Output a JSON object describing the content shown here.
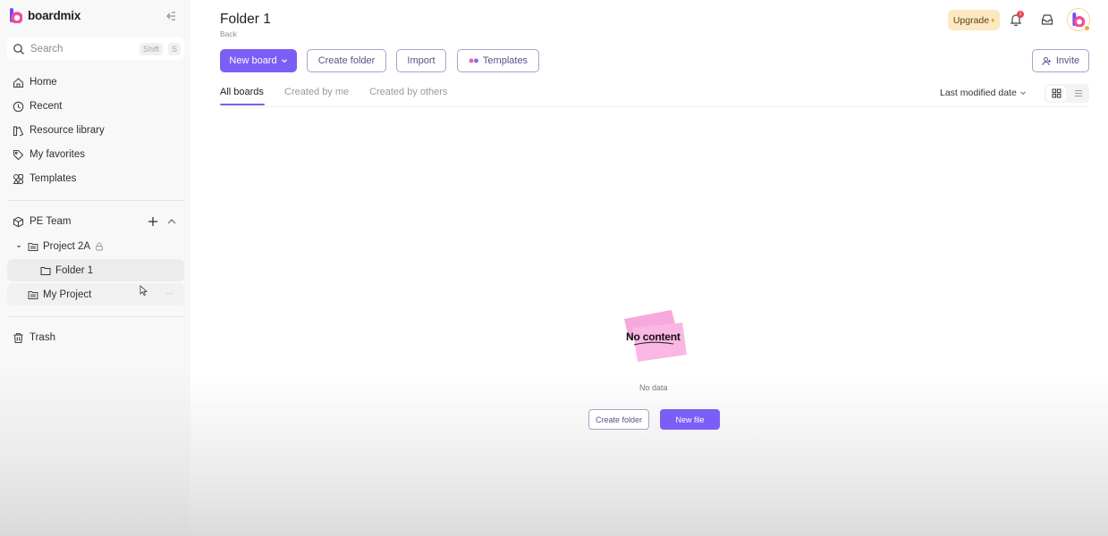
{
  "app": {
    "name": "boardmix",
    "accent": "#7b5ef5"
  },
  "sidebar": {
    "search": {
      "placeholder": "Search",
      "shortcut_key1": "Shift",
      "shortcut_key2": "S"
    },
    "nav": [
      {
        "label": "Home",
        "icon": "home-icon"
      },
      {
        "label": "Recent",
        "icon": "clock-icon"
      },
      {
        "label": "Resource library",
        "icon": "library-icon"
      },
      {
        "label": "My favorites",
        "icon": "tag-icon"
      },
      {
        "label": "Templates",
        "icon": "templates-icon"
      }
    ],
    "team": {
      "label": "PE Team",
      "icon": "cube-icon"
    },
    "tree": [
      {
        "label": "Project 2A",
        "icon": "project-folder-icon",
        "locked": true,
        "expanded": true
      },
      {
        "label": "Folder 1",
        "icon": "folder-icon",
        "selected": true
      },
      {
        "label": "My Project",
        "icon": "project-folder-icon",
        "more": "..."
      }
    ],
    "trash": {
      "label": "Trash",
      "icon": "trash-icon"
    }
  },
  "header": {
    "title": "Folder 1",
    "back": "Back",
    "upgrade": "Upgrade",
    "notifications_count": "1"
  },
  "toolbar": {
    "new_board": "New board",
    "create_folder": "Create folder",
    "import": "Import",
    "templates": "Templates",
    "invite": "Invite"
  },
  "tabs": [
    {
      "label": "All boards",
      "active": true
    },
    {
      "label": "Created by me",
      "active": false
    },
    {
      "label": "Created by others",
      "active": false
    }
  ],
  "sort": {
    "label": "Last modified date"
  },
  "view": {
    "active": "grid"
  },
  "empty": {
    "sticker_text": "No content",
    "message": "No data",
    "create_folder": "Create folder",
    "new_file": "New file"
  }
}
